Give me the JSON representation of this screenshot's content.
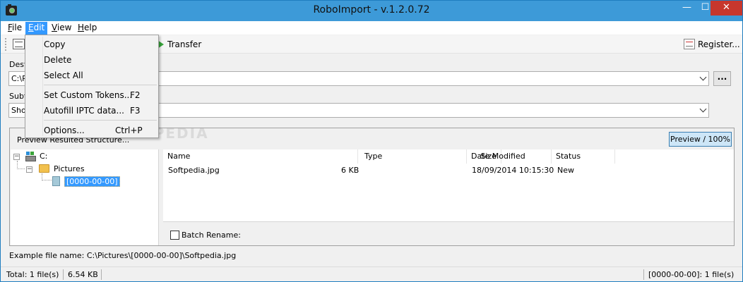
{
  "window": {
    "title": "RoboImport - v.1.2.0.72",
    "minimize_glyph": "—",
    "maximize_glyph": "☐",
    "close_glyph": "✕"
  },
  "menubar": {
    "items": [
      {
        "label": "File",
        "key": "F",
        "rest": "ile"
      },
      {
        "label": "Edit",
        "key": "E",
        "rest": "dit"
      },
      {
        "label": "View",
        "key": "V",
        "rest": "iew"
      },
      {
        "label": "Help",
        "key": "H",
        "rest": "elp"
      }
    ],
    "active": "Edit"
  },
  "toolbar": {
    "transfer_label": "Transfer",
    "register_label": "Register..."
  },
  "form": {
    "destination_label": "Dest",
    "destination_value": "C:\\P",
    "subfolder_label": "Subf",
    "subfolder_value": "Sho",
    "browse_label": "..."
  },
  "edit_menu": {
    "items": [
      {
        "label": "Copy",
        "shortcut": ""
      },
      {
        "label": "Delete",
        "shortcut": ""
      },
      {
        "label": "Select All",
        "shortcut": ""
      },
      {
        "label": "Set Custom Tokens...",
        "shortcut": "F2"
      },
      {
        "label": "Autofill IPTC data...",
        "shortcut": "F3"
      },
      {
        "label": "Options...",
        "shortcut": "Ctrl+P"
      }
    ]
  },
  "preview": {
    "header_label": "Preview Resulted Structure...",
    "zoom_button": "Preview / 100%",
    "tree": {
      "root": "C:",
      "folder": "Pictures",
      "selected": "[0000-00-00]",
      "expand_glyph": "−"
    },
    "columns": [
      "Name",
      "Size",
      "Type",
      "Date Modified",
      "Status"
    ],
    "rows": [
      {
        "name": "Softpedia.jpg",
        "size": "6 KB",
        "type": "",
        "date": "18/09/2014 10:15:30",
        "status": "New"
      }
    ],
    "batch_rename_label": "Batch Rename:"
  },
  "example": "Example file name:  C:\\Pictures\\[0000-00-00]\\Softpedia.jpg",
  "status": {
    "total": "Total: 1 file(s)",
    "size": "6.54 KB",
    "right": "[0000-00-00]: 1 file(s)"
  },
  "watermark": "SOFTPEDIA",
  "colors": {
    "titlebar": "#3d9ad8",
    "accent": "#3399ff",
    "close": "#c7372d"
  }
}
